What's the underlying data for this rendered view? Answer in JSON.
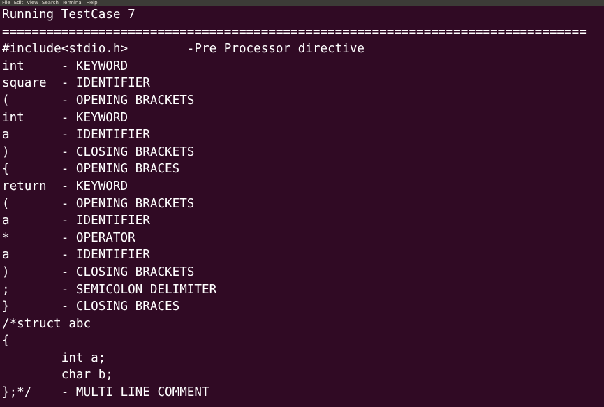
{
  "menubar": {
    "items": [
      "File",
      "Edit",
      "View",
      "Search",
      "Terminal",
      "Help"
    ]
  },
  "terminal": {
    "lines": [
      "Running TestCase 7",
      "===============================================================================",
      "#include<stdio.h>        -Pre Processor directive",
      "int     - KEYWORD",
      "square  - IDENTIFIER",
      "(       - OPENING BRACKETS",
      "int     - KEYWORD",
      "a       - IDENTIFIER",
      ")       - CLOSING BRACKETS",
      "{       - OPENING BRACES",
      "return  - KEYWORD",
      "(       - OPENING BRACKETS",
      "a       - IDENTIFIER",
      "*       - OPERATOR",
      "a       - IDENTIFIER",
      ")       - CLOSING BRACKETS",
      ";       - SEMICOLON DELIMITER",
      "}       - CLOSING BRACES",
      "/*struct abc",
      "{",
      "        int a;",
      "        char b;",
      "};*/    - MULTI LINE COMMENT"
    ]
  }
}
